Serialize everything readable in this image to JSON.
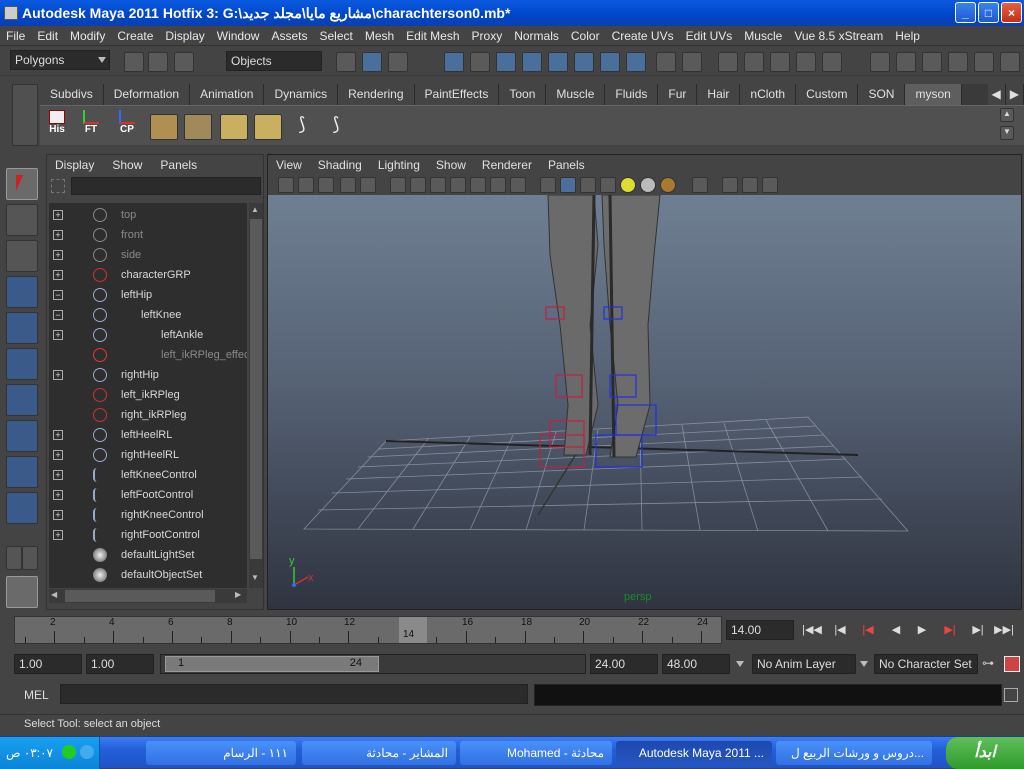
{
  "window": {
    "title": "Autodesk Maya 2011 Hotfix 3: G:\\مشاريع مايا\\مجلد جديد\\charachterson0.mb*",
    "controls": [
      "_",
      "□",
      "×"
    ]
  },
  "menubar": [
    "File",
    "Edit",
    "Modify",
    "Create",
    "Display",
    "Window",
    "Assets",
    "Select",
    "Mesh",
    "Edit Mesh",
    "Proxy",
    "Normals",
    "Color",
    "Create UVs",
    "Edit UVs",
    "Muscle",
    "Vue 8.5 xStream",
    "Help"
  ],
  "statusline": {
    "menuset": "Polygons",
    "selection_mode": "Objects"
  },
  "shelf": {
    "tabs": [
      "Subdivs",
      "Deformation",
      "Animation",
      "Dynamics",
      "Rendering",
      "PaintEffects",
      "Toon",
      "Muscle",
      "Fluids",
      "Fur",
      "Hair",
      "nCloth",
      "Custom",
      "SON",
      "myson"
    ],
    "active_tab": "myson",
    "buttons": [
      "His",
      "FT",
      "CP"
    ]
  },
  "outliner": {
    "menu": [
      "Display",
      "Show",
      "Panels"
    ],
    "rows": [
      {
        "label": "top",
        "expand": "+",
        "indent": 0,
        "dim": true,
        "icon": "camera-icon"
      },
      {
        "label": "front",
        "expand": "+",
        "indent": 0,
        "dim": true,
        "icon": "camera-icon"
      },
      {
        "label": "side",
        "expand": "+",
        "indent": 0,
        "dim": true,
        "icon": "camera-icon"
      },
      {
        "label": "characterGRP",
        "expand": "+",
        "indent": 0,
        "dim": false,
        "icon": "group-icon"
      },
      {
        "label": "leftHip",
        "expand": "−",
        "indent": 0,
        "dim": false,
        "icon": "joint-icon"
      },
      {
        "label": "leftKnee",
        "expand": "−",
        "indent": 1,
        "dim": false,
        "icon": "joint-icon"
      },
      {
        "label": "leftAnkle",
        "expand": "+",
        "indent": 2,
        "dim": false,
        "icon": "joint-icon"
      },
      {
        "label": "left_ikRPleg_effector",
        "expand": "",
        "indent": 2,
        "dim": true,
        "icon": "effector-icon"
      },
      {
        "label": "rightHip",
        "expand": "+",
        "indent": 0,
        "dim": false,
        "icon": "joint-icon"
      },
      {
        "label": "left_ikRPleg",
        "expand": "",
        "indent": 0,
        "dim": false,
        "icon": "ik-handle-icon"
      },
      {
        "label": "right_ikRPleg",
        "expand": "",
        "indent": 0,
        "dim": false,
        "icon": "ik-handle-icon"
      },
      {
        "label": "leftHeelRL",
        "expand": "+",
        "indent": 0,
        "dim": false,
        "icon": "joint-icon"
      },
      {
        "label": "rightHeelRL",
        "expand": "+",
        "indent": 0,
        "dim": false,
        "icon": "joint-icon"
      },
      {
        "label": "leftKneeControl",
        "expand": "+",
        "indent": 0,
        "dim": false,
        "icon": "curve-icon"
      },
      {
        "label": "leftFootControl",
        "expand": "+",
        "indent": 0,
        "dim": false,
        "icon": "curve-icon"
      },
      {
        "label": "rightKneeControl",
        "expand": "+",
        "indent": 0,
        "dim": false,
        "icon": "curve-icon"
      },
      {
        "label": "rightFootControl",
        "expand": "+",
        "indent": 0,
        "dim": false,
        "icon": "curve-icon"
      },
      {
        "label": "defaultLightSet",
        "expand": "",
        "indent": 0,
        "dim": false,
        "icon": "set-icon"
      },
      {
        "label": "defaultObjectSet",
        "expand": "",
        "indent": 0,
        "dim": false,
        "icon": "set-icon"
      }
    ]
  },
  "viewport": {
    "menu": [
      "View",
      "Shading",
      "Lighting",
      "Show",
      "Renderer",
      "Panels"
    ],
    "camera_label": "persp",
    "axis_y": "y",
    "axis_x": "x"
  },
  "timeline": {
    "ticks": [
      "2",
      "4",
      "6",
      "8",
      "10",
      "12",
      "14",
      "16",
      "18",
      "20",
      "22",
      "24"
    ],
    "current_frame_marker": "14",
    "current_frame": "14.00"
  },
  "range": {
    "start_time": "1.00",
    "playback_start": "1.00",
    "range_min": "1",
    "range_max": "24",
    "playback_end": "24.00",
    "end_time": "48.00",
    "anim_layer": "No Anim Layer",
    "character_set": "No Character Set"
  },
  "commandline": {
    "label": "MEL"
  },
  "helpline": {
    "text": "Select Tool: select an object"
  },
  "taskbar": {
    "start_label": "ابدأ",
    "clock": "٠٣:٠٧ ص",
    "tasks": [
      "دروس و ورشات الربيع ل...",
      "Autodesk Maya 2011 ...",
      "Mohamed - محادثة",
      "المشاير - محادثة",
      "١١١ - الرسام"
    ]
  }
}
